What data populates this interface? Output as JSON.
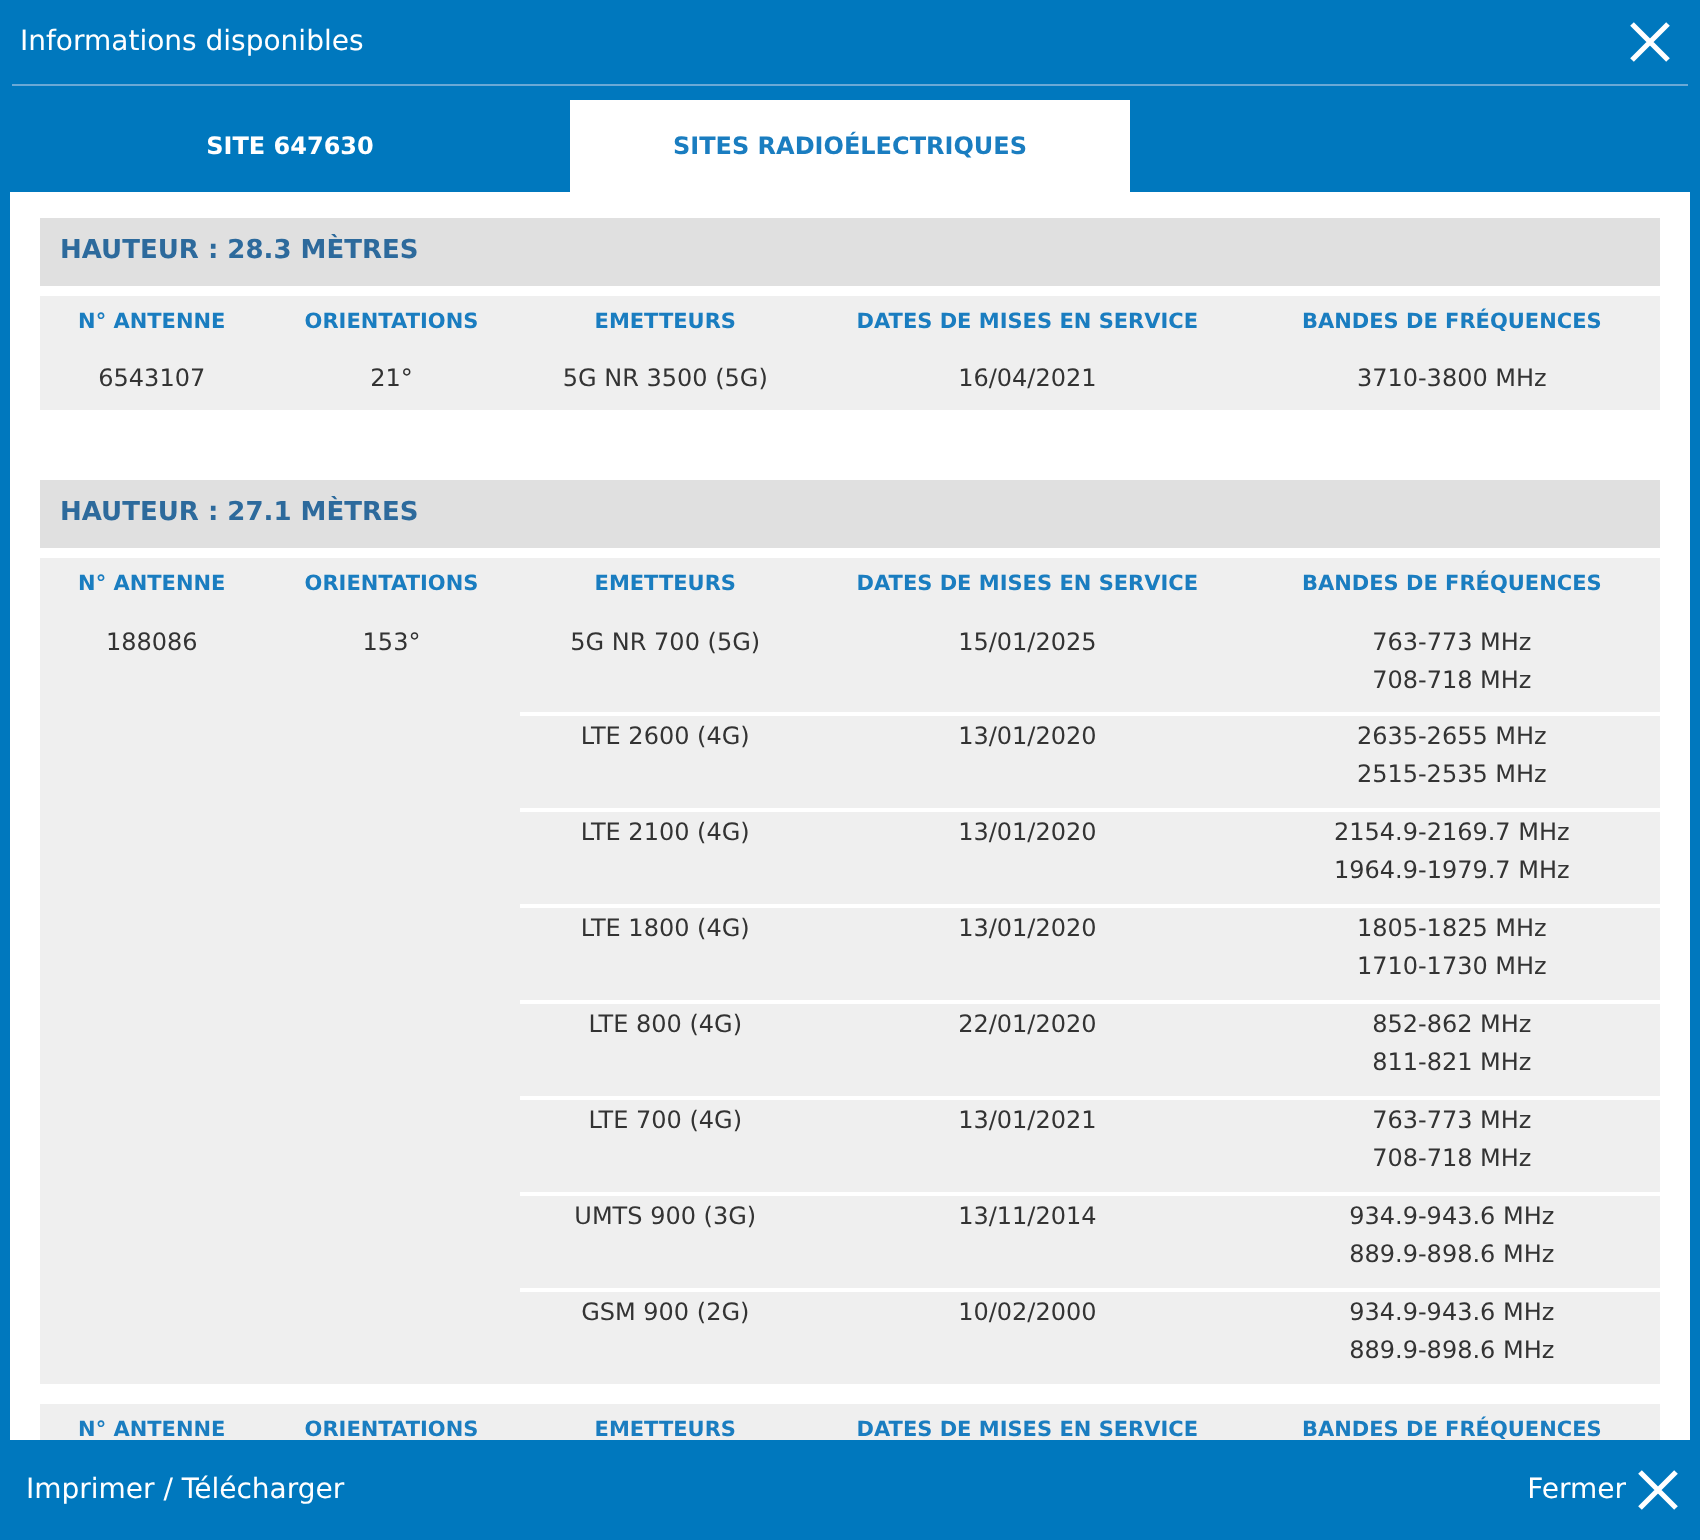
{
  "window": {
    "title": "Informations disponibles"
  },
  "tabs": [
    {
      "label": "SITE 647630",
      "selected": false
    },
    {
      "label": "SITES RADIOÉLECTRIQUES",
      "selected": true
    }
  ],
  "heights": [
    {
      "title": "HAUTEUR : 28.3 MÈTRES",
      "antennas": [
        {
          "columns": [
            "N° ANTENNE",
            "ORIENTATIONS",
            "EMETTEURS",
            "DATES DE MISES EN SERVICE",
            "BANDES DE FRÉQUENCES"
          ],
          "number": "6543107",
          "orientation": "21°",
          "emitters": [
            {
              "name": "5G NR 3500 (5G)",
              "date": "16/04/2021",
              "bands": [
                "3710-3800 MHz"
              ]
            }
          ]
        }
      ]
    },
    {
      "title": "HAUTEUR : 27.1 MÈTRES",
      "antennas": [
        {
          "columns": [
            "N° ANTENNE",
            "ORIENTATIONS",
            "EMETTEURS",
            "DATES DE MISES EN SERVICE",
            "BANDES DE FRÉQUENCES"
          ],
          "number": "188086",
          "orientation": "153°",
          "emitters": [
            {
              "name": "5G NR 700 (5G)",
              "date": "15/01/2025",
              "bands": [
                "763-773 MHz",
                "708-718 MHz"
              ]
            },
            {
              "name": "LTE 2600 (4G)",
              "date": "13/01/2020",
              "bands": [
                "2635-2655 MHz",
                "2515-2535 MHz"
              ]
            },
            {
              "name": "LTE 2100 (4G)",
              "date": "13/01/2020",
              "bands": [
                "2154.9-2169.7 MHz",
                "1964.9-1979.7 MHz"
              ]
            },
            {
              "name": "LTE 1800 (4G)",
              "date": "13/01/2020",
              "bands": [
                "1805-1825 MHz",
                "1710-1730 MHz"
              ]
            },
            {
              "name": "LTE 800 (4G)",
              "date": "22/01/2020",
              "bands": [
                "852-862 MHz",
                "811-821 MHz"
              ]
            },
            {
              "name": "LTE 700 (4G)",
              "date": "13/01/2021",
              "bands": [
                "763-773 MHz",
                "708-718 MHz"
              ]
            },
            {
              "name": "UMTS 900 (3G)",
              "date": "13/11/2014",
              "bands": [
                "934.9-943.6 MHz",
                "889.9-898.6 MHz"
              ]
            },
            {
              "name": "GSM 900 (2G)",
              "date": "10/02/2000",
              "bands": [
                "934.9-943.6 MHz",
                "889.9-898.6 MHz"
              ]
            }
          ]
        },
        {
          "columns": [
            "N° ANTENNE",
            "ORIENTATIONS",
            "EMETTEURS",
            "DATES DE MISES EN SERVICE",
            "BANDES DE FRÉQUENCES"
          ]
        }
      ]
    }
  ],
  "footer": {
    "print_link": "Imprimer / Télécharger",
    "close_button": "Fermer"
  }
}
